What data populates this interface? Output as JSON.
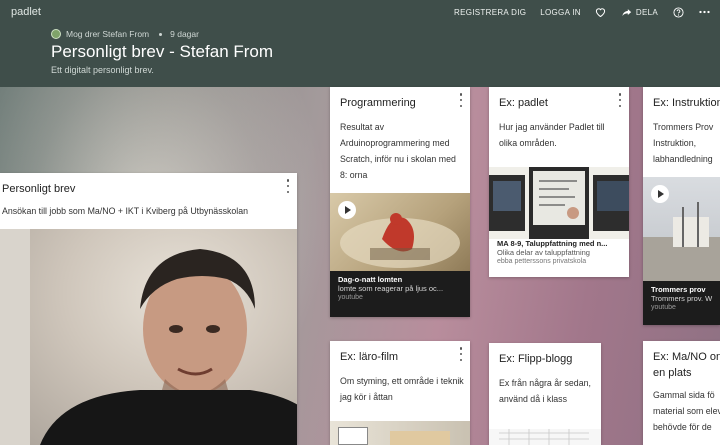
{
  "header": {
    "brand": "padlet",
    "author": "Mog drer Stefan From",
    "age": "9 dagar",
    "title": "Personligt brev - Stefan From",
    "subtitle": "Ett digitalt personligt brev.",
    "nav": {
      "register": "REGISTRERA DIG",
      "login": "LOGGA IN",
      "share": "DELA"
    }
  },
  "cards": {
    "personligt": {
      "title": "Personligt brev",
      "body": "Ansökan till jobb som Ma/NO + IKT i Kviberg på Utbynässkolan"
    },
    "programmering": {
      "title": "Programmering",
      "body": "Resultat av Arduinoprogrammering med Scratch, inför nu i skolan med 8: orna",
      "cap1": "Dag-o-natt lomten",
      "cap2": "lomte som reagerar på ljus oc...",
      "cap3": "youtube"
    },
    "padlet": {
      "title": "Ex: padlet",
      "body": "Hur jag använder Padlet till olika områden.",
      "cap1": "MA 8-9, Taluppfattning med n...",
      "cap2": "Olika delar av taluppfattning",
      "cap3": "ebba petterssons privatskola"
    },
    "instruktion": {
      "title": "Ex: Instruktion",
      "body": "Trommers Prov Instruktion, labhandledning",
      "cap1": "Trommers prov",
      "cap2": "Trommers prov. W",
      "cap3": "youtube"
    },
    "larofilm": {
      "title": "Ex: läro-film",
      "body": "Om styming, ett område i teknik jag kör i åttan"
    },
    "flipp": {
      "title": "Ex: Flipp-blogg",
      "body": "Ex från några år sedan, använd då i klass"
    },
    "mano": {
      "title": "Ex: Ma/NO on en plats",
      "body": "Gammal sida fö material som eleve behövde för de"
    }
  }
}
